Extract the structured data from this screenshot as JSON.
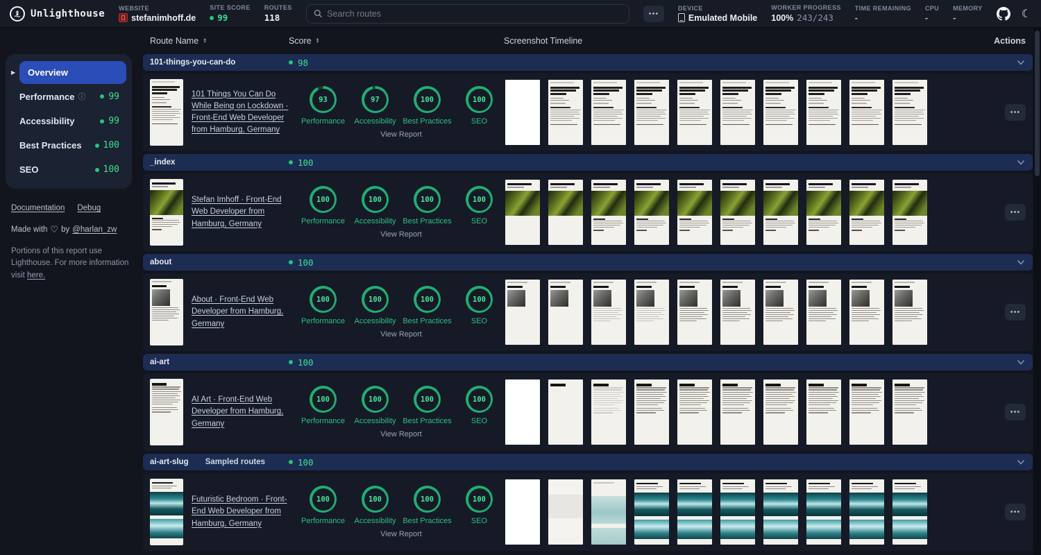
{
  "header": {
    "app_name": "Unlighthouse",
    "website_label": "WEBSITE",
    "website_value": "stefanimhoff.de",
    "site_score_label": "SITE SCORE",
    "site_score_value": "99",
    "routes_label": "ROUTES",
    "routes_value": "118",
    "search_placeholder": "Search routes",
    "more_button": "•••",
    "device_label": "DEVICE",
    "device_value": "Emulated Mobile",
    "worker_progress_label": "WORKER PROGRESS",
    "worker_progress_pct": "100%",
    "worker_progress_count": "243/243",
    "time_remaining_label": "TIME REMAINING",
    "time_remaining_value": "-",
    "cpu_label": "CPU",
    "cpu_value": "-",
    "memory_label": "MEMORY",
    "memory_value": "-"
  },
  "sidebar": {
    "overview_label": "Overview",
    "items": [
      {
        "label": "Performance",
        "score": "99",
        "info": true
      },
      {
        "label": "Accessibility",
        "score": "99",
        "info": false
      },
      {
        "label": "Best Practices",
        "score": "100",
        "info": false
      },
      {
        "label": "SEO",
        "score": "100",
        "info": false
      }
    ],
    "links": [
      "Documentation",
      "Debug"
    ],
    "credit_prefix": "Made with",
    "credit_by": "by",
    "credit_link": "@harlan_zw",
    "notice_text": "Portions of this report use Lighthouse. For more information visit",
    "notice_link": "here."
  },
  "table": {
    "columns": {
      "route": "Route Name",
      "score": "Score",
      "timeline": "Screenshot Timeline",
      "actions": "Actions"
    },
    "metric_labels": [
      "Performance",
      "Accessibility",
      "Best Practices",
      "SEO"
    ],
    "view_report_label": "View Report",
    "row_actions_label": "•••",
    "groups": [
      {
        "route": "101-things-you-can-do",
        "badge": "",
        "group_score": "98",
        "title": "101 Things You Can Do While Being on Lockdown · Front-End Web Developer from Hamburg, Germany",
        "scores": [
          "93",
          "97",
          "100",
          "100"
        ],
        "thumb_kind": "lockdown",
        "timeline": [
          "blank",
          "full",
          "full",
          "full",
          "full",
          "full",
          "full",
          "full",
          "full",
          "full"
        ]
      },
      {
        "route": "_index",
        "badge": "",
        "group_score": "100",
        "title": "Stefan Imhoff · Front-End Web Developer from Hamburg, Germany",
        "scores": [
          "100",
          "100",
          "100",
          "100"
        ],
        "thumb_kind": "index",
        "timeline": [
          "partial",
          "partial",
          "full",
          "full",
          "full",
          "full",
          "full",
          "full",
          "full",
          "full"
        ]
      },
      {
        "route": "about",
        "badge": "",
        "group_score": "100",
        "title": "About · Front-End Web Developer from Hamburg, Germany",
        "scores": [
          "100",
          "100",
          "100",
          "100"
        ],
        "thumb_kind": "about",
        "timeline": [
          "partial",
          "partial",
          "light",
          "light",
          "full",
          "full",
          "full",
          "full",
          "full",
          "full"
        ]
      },
      {
        "route": "ai-art",
        "badge": "",
        "group_score": "100",
        "title": "AI Art · Front-End Web Developer from Hamburg, Germany",
        "scores": [
          "100",
          "100",
          "100",
          "100"
        ],
        "thumb_kind": "aiart",
        "timeline": [
          "blank",
          "heading",
          "light",
          "full",
          "full",
          "full",
          "full",
          "full",
          "full",
          "full"
        ]
      },
      {
        "route": "ai-art-slug",
        "badge": "Sampled routes",
        "group_score": "100",
        "title": "Futuristic Bedroom · Front-End Web Developer from Hamburg, Germany",
        "scores": [
          "100",
          "100",
          "100",
          "100"
        ],
        "thumb_kind": "bedroom",
        "timeline": [
          "blank",
          "faint",
          "blur",
          "full",
          "full",
          "full",
          "full",
          "full",
          "full",
          "full"
        ]
      }
    ]
  },
  "colors": {
    "accent_green": "#3ee095",
    "ring_green": "#1fae72",
    "ring_track": "#1e3b34",
    "group_row_bg": "#1d2c52",
    "active_nav_bg": "#2b4db8"
  }
}
